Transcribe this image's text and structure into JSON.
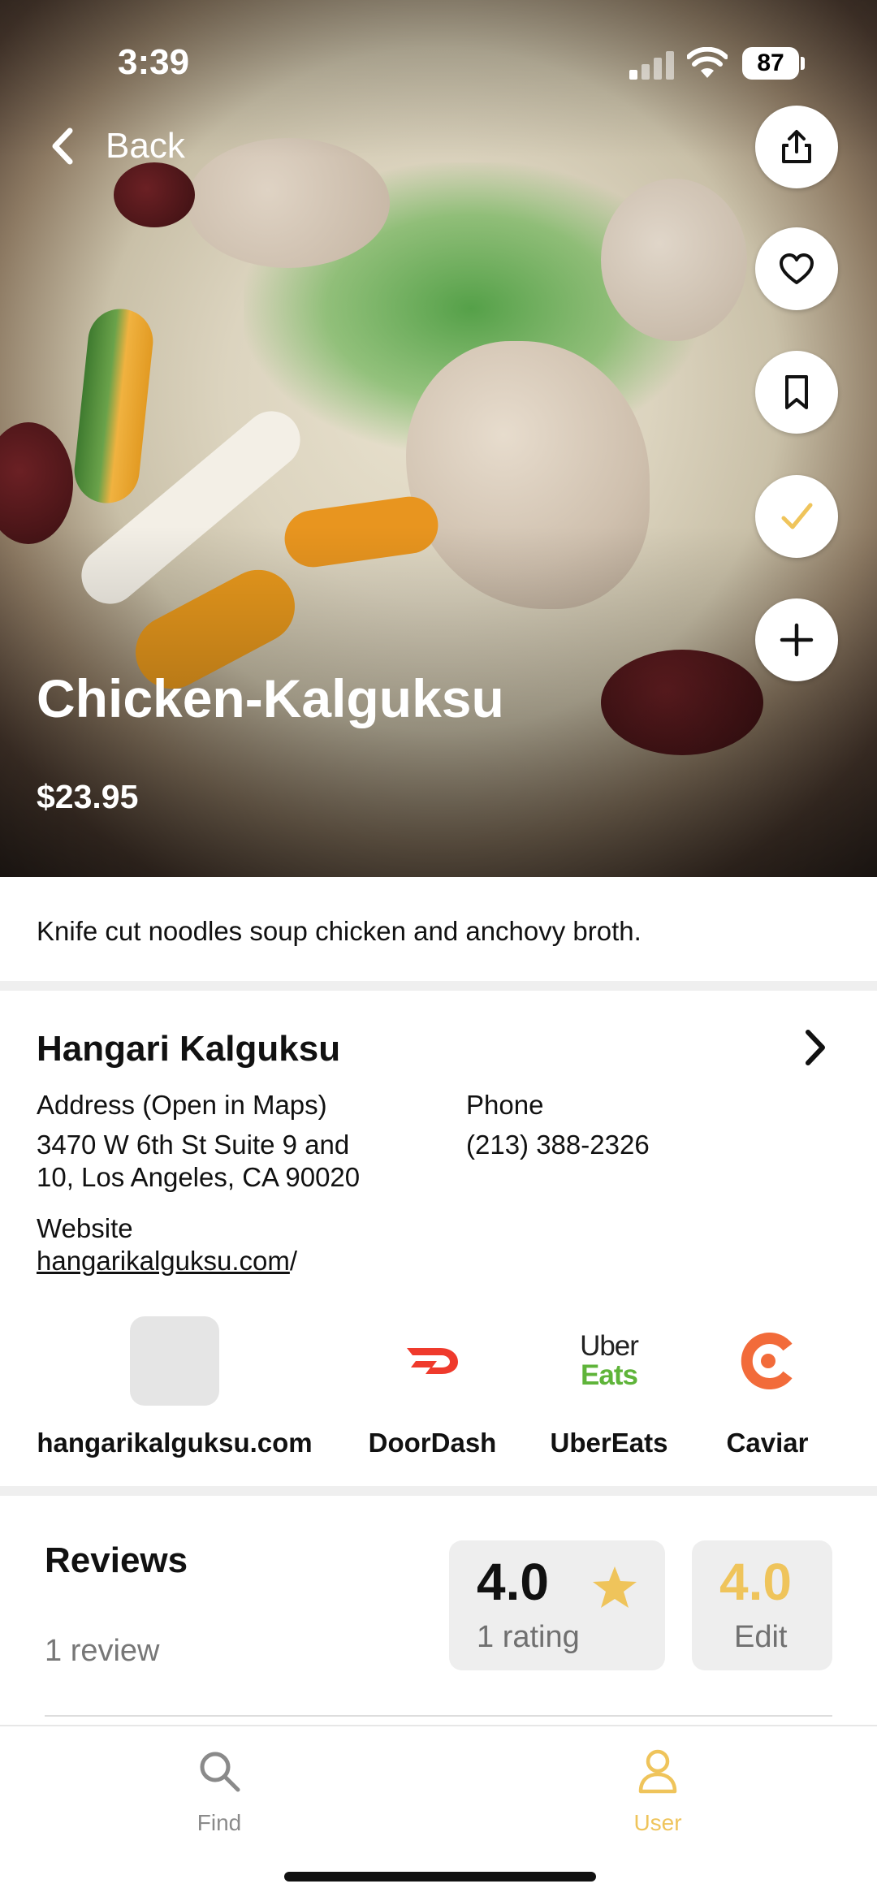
{
  "status_bar": {
    "time": "3:39",
    "battery": "87"
  },
  "nav": {
    "back_label": "Back"
  },
  "actions": [
    {
      "name": "share-button",
      "icon": "share-icon"
    },
    {
      "name": "favorite-button",
      "icon": "heart-icon"
    },
    {
      "name": "bookmark-button",
      "icon": "bookmark-icon"
    },
    {
      "name": "tried-button",
      "icon": "check-icon"
    },
    {
      "name": "add-button",
      "icon": "plus-icon"
    }
  ],
  "dish": {
    "title": "Chicken-Kalguksu",
    "price": "$23.95",
    "description": "Knife cut noodles soup chicken and anchovy broth."
  },
  "restaurant": {
    "name": "Hangari Kalguksu",
    "address_label": "Address (Open in Maps)",
    "address_line1": "3470 W 6th St Suite 9 and",
    "address_line2": "10, Los Angeles, CA 90020",
    "phone_label": "Phone",
    "phone": "(213) 388-2326",
    "website_label": "Website",
    "website_link": "hangarikalguksu.com",
    "website_suffix": "/"
  },
  "ordering": [
    {
      "label": "hangarikalguksu.com",
      "icon": "website-placeholder-icon"
    },
    {
      "label": "DoorDash",
      "icon": "doordash-logo"
    },
    {
      "label": "UberEats",
      "icon": "ubereats-logo",
      "logo_line1": "Uber",
      "logo_line2": "Eats"
    },
    {
      "label": "Caviar",
      "icon": "caviar-logo"
    }
  ],
  "reviews": {
    "title": "Reviews",
    "count": "1 review",
    "average": "4.0",
    "ratings": "1 rating",
    "my_rating": "4.0",
    "edit_label": "Edit"
  },
  "tabs": [
    {
      "label": "Find",
      "active": false
    },
    {
      "label": "User",
      "active": true
    }
  ],
  "colors": {
    "accent": "#EFC45B",
    "doordash": "#EF3A2C",
    "ubereats_green": "#06C167",
    "caviar": "#F26B3A",
    "inactive_tab": "#8A8A8A"
  }
}
